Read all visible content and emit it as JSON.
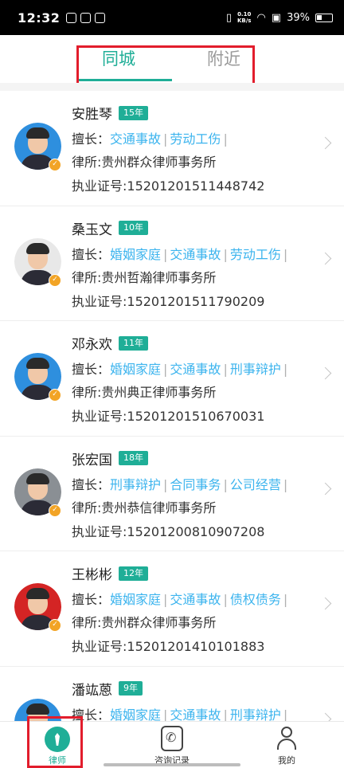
{
  "status_bar": {
    "time": "12:32",
    "net_speed_value": "0.10",
    "net_speed_unit": "KB/s",
    "battery": "39%"
  },
  "tabs": {
    "city": "同城",
    "nearby": "附近"
  },
  "lawyers": [
    {
      "name": "安胜琴",
      "years": "15年",
      "specialty_label": "擅长：",
      "specialties": [
        "交通事故",
        "劳动工伤"
      ],
      "firm": "律所:贵州群众律师事务所",
      "license": "执业证号:15201201511448742",
      "avatar_bg": "#2e8fde"
    },
    {
      "name": "桑玉文",
      "years": "10年",
      "specialty_label": "擅长：",
      "specialties": [
        "婚姻家庭",
        "交通事故",
        "劳动工伤"
      ],
      "firm": "律所:贵州哲瀚律师事务所",
      "license": "执业证号:15201201511790209",
      "avatar_bg": "#e8e8e8"
    },
    {
      "name": "邓永欢",
      "years": "11年",
      "specialty_label": "擅长：",
      "specialties": [
        "婚姻家庭",
        "交通事故",
        "刑事辩护"
      ],
      "firm": "律所:贵州典正律师事务所",
      "license": "执业证号:15201201510670031",
      "avatar_bg": "#2e8fde"
    },
    {
      "name": "张宏国",
      "years": "18年",
      "specialty_label": "擅长：",
      "specialties": [
        "刑事辩护",
        "合同事务",
        "公司经营"
      ],
      "firm": "律所:贵州恭信律师事务所",
      "license": "执业证号:15201200810907208",
      "avatar_bg": "#8a8f94"
    },
    {
      "name": "王彬彬",
      "years": "12年",
      "specialty_label": "擅长：",
      "specialties": [
        "婚姻家庭",
        "交通事故",
        "债权债务"
      ],
      "firm": "律所:贵州群众律师事务所",
      "license": "执业证号:15201201410101883",
      "avatar_bg": "#d42424"
    },
    {
      "name": "潘竑蒽",
      "years": "9年",
      "specialty_label": "擅长：",
      "specialties": [
        "婚姻家庭",
        "交通事故",
        "刑事辩护"
      ],
      "firm": "",
      "license": "",
      "avatar_bg": "#2e8fde"
    }
  ],
  "bottom_nav": {
    "lawyer": "律师",
    "records": "咨询记录",
    "mine": "我的"
  },
  "colors": {
    "accent": "#1fae97",
    "specialty_link": "#3cb4ee",
    "badge": "#f2a426",
    "highlight": "#e21d2c"
  },
  "icons": {
    "avatar_badge": "v-badge-icon",
    "card_arrow": "chevron-right-icon",
    "nav_lawyer": "tie-icon",
    "nav_records": "phone-record-icon",
    "nav_mine": "person-icon"
  }
}
